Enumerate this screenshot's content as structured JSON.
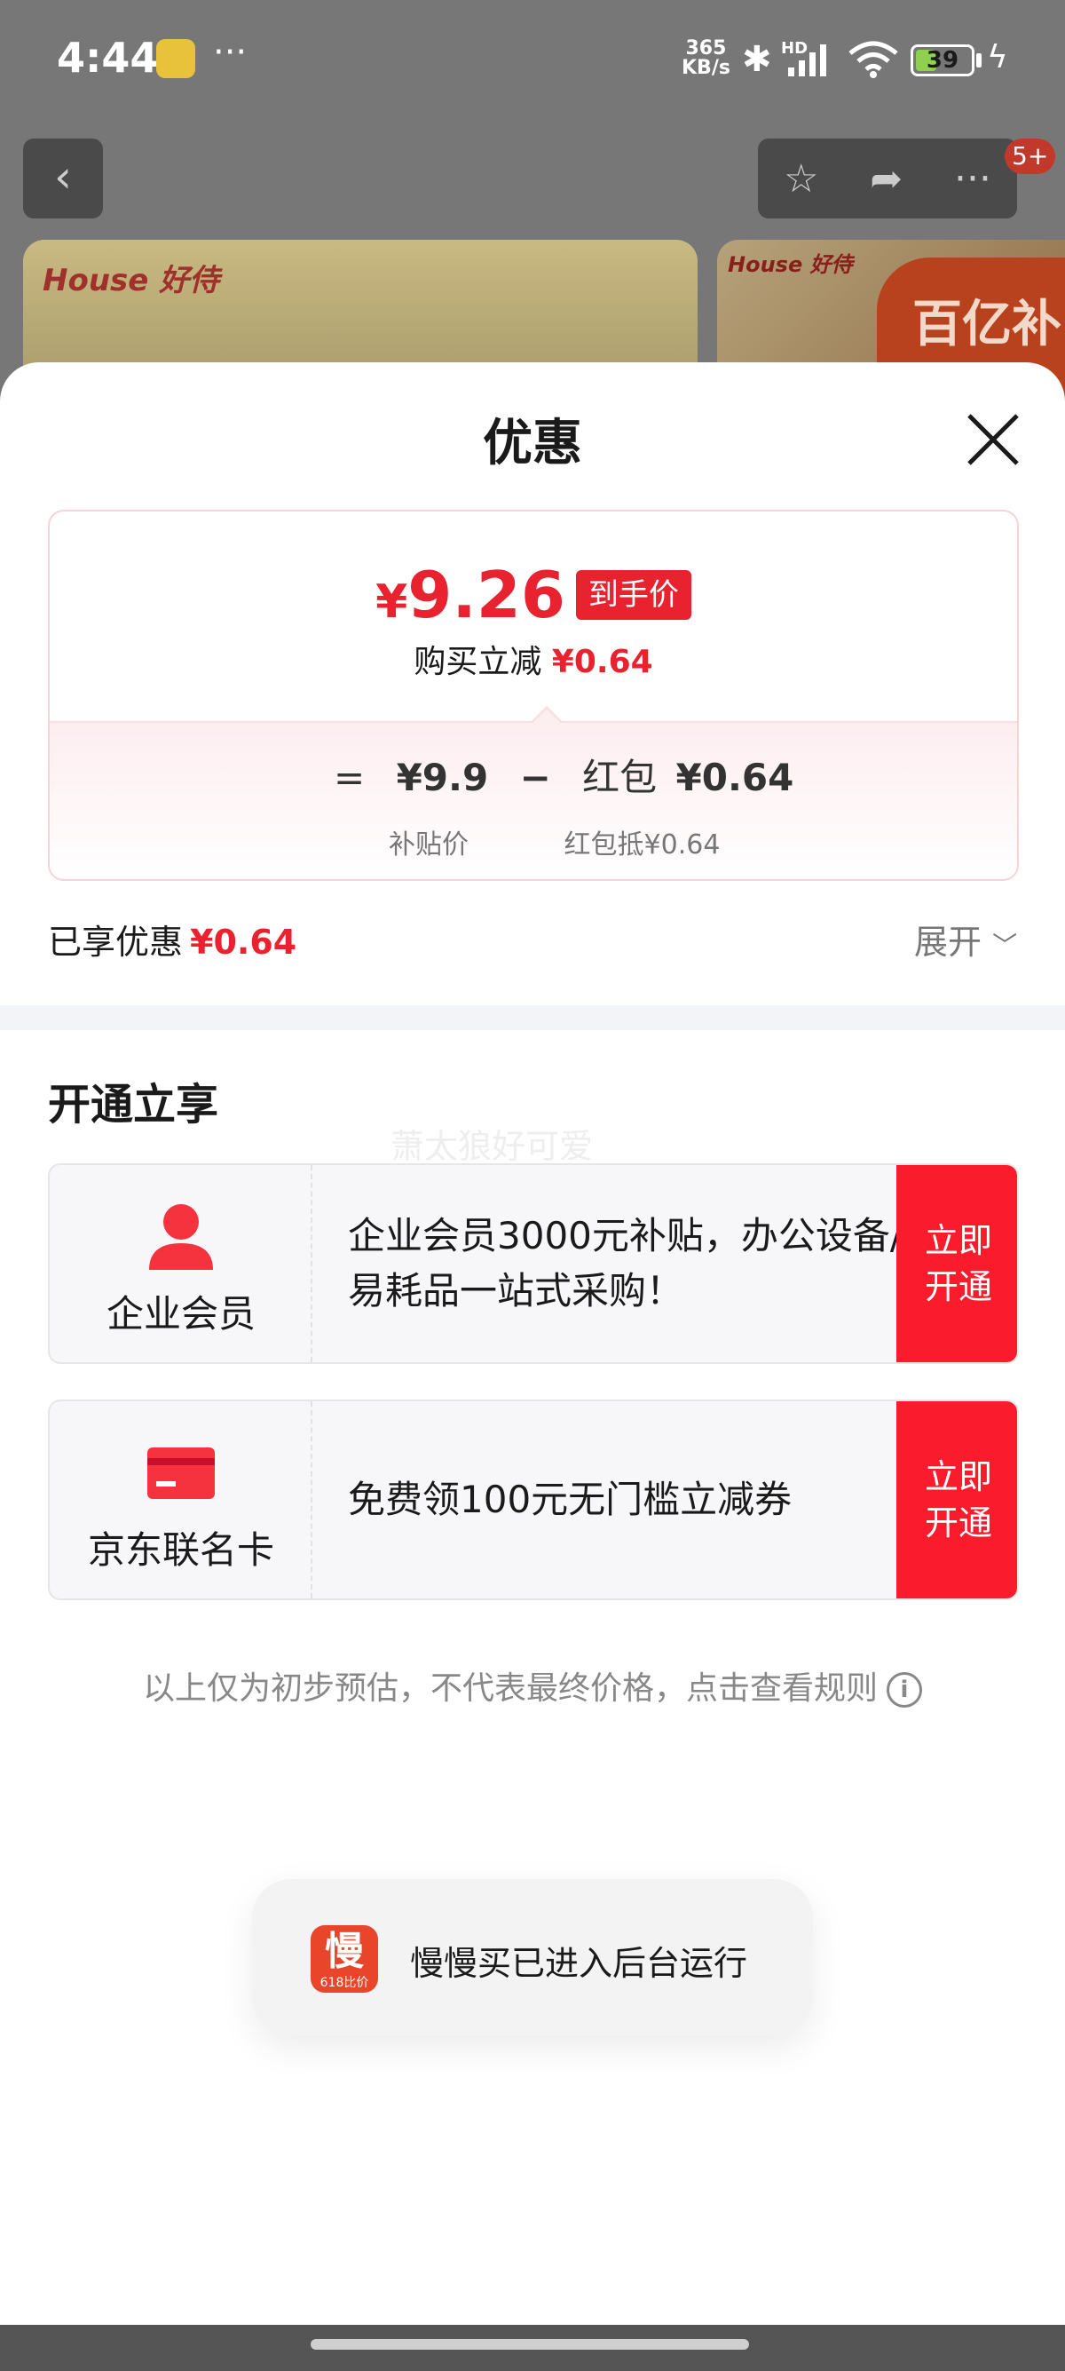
{
  "status_bar": {
    "time": "4:44",
    "more": "···",
    "net_speed_value": "365",
    "net_speed_unit": "KB/s",
    "hd_label": "HD",
    "battery": "39",
    "battery_level": 0.39,
    "icons": [
      "app-notification-icon",
      "bluetooth-icon",
      "signal-icon",
      "wifi-icon",
      "battery-icon",
      "charging-icon"
    ]
  },
  "background_page": {
    "brand_left": "House 好侍",
    "brand_right": "House 好侍",
    "banner_tag": "百亿补贴",
    "nav_badge": "5+",
    "nav_icons": [
      "back-icon",
      "star-icon",
      "share-icon",
      "more-icon"
    ]
  },
  "sheet": {
    "title": "优惠",
    "close_icon": "close-icon",
    "price": {
      "currency": "¥",
      "value": "9.26",
      "tag": "到手价",
      "sub_label": "购买立减",
      "sub_value": "¥0.64"
    },
    "formula": {
      "equals": "=",
      "base_price": "¥9.9",
      "minus": "−",
      "item_label": "红包",
      "item_value": "¥0.64",
      "base_caption": "补贴价",
      "item_caption": "红包抵¥0.64"
    },
    "enjoyed": {
      "label": "已享优惠",
      "value": "¥0.64",
      "expand": "展开"
    },
    "section": {
      "title": "开通立享",
      "watermark": "萧太狼好可爱"
    },
    "offers": [
      {
        "icon": "person-icon",
        "name": "企业会员",
        "description": "企业会员3000元补贴，办公设备/易耗品一站式采购！",
        "button": "立即开通"
      },
      {
        "icon": "card-icon",
        "name": "京东联名卡",
        "description": "免费领100元无门槛立减券",
        "button": "立即开通"
      }
    ],
    "disclaimer": "以上仅为初步预估，不代表最终价格，点击查看规则",
    "disclaimer_icon": "info-icon"
  },
  "toast": {
    "icon_glyph": "慢",
    "icon_caption": "618比价",
    "message": "慢慢买已进入后台运行"
  },
  "colors": {
    "accent_red": "#e8222e",
    "button_red": "#fa1c2c",
    "overlay": "#6e6e6e"
  }
}
